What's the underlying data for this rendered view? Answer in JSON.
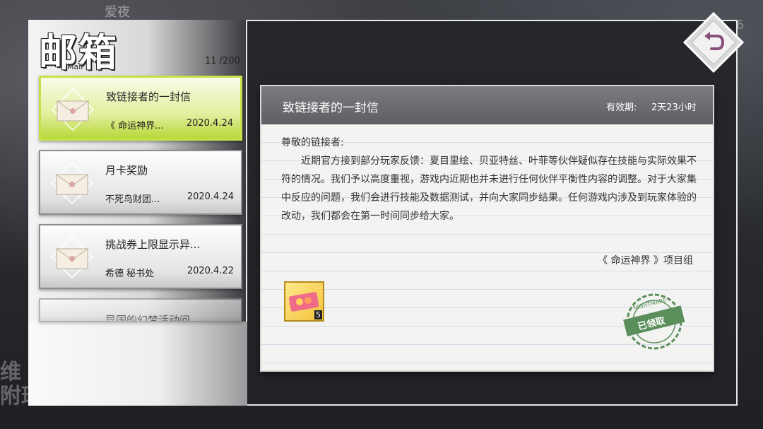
{
  "background": {
    "top_text": "爱夜",
    "corner_number": "6",
    "side_text": "维\n附班"
  },
  "header": {
    "title": "邮箱",
    "subtitle": "Mail",
    "count": "11 /200"
  },
  "mails": [
    {
      "title": "致链接者的一封信",
      "sender": "《 命运神界...",
      "date": "2020.4.24",
      "active": true
    },
    {
      "title": "月卡奖励",
      "sender": "不死鸟财团...",
      "date": "2020.4.24",
      "active": false
    },
    {
      "title": "挑战券上限显示异...",
      "sender": "希德 秘书处",
      "date": "2020.4.22",
      "active": false
    },
    {
      "title": "异国的幻梦活动问...",
      "sender": "",
      "date": "",
      "active": false
    }
  ],
  "detail": {
    "title": "致链接者的一封信",
    "expiry_label": "有效期:",
    "expiry_value": "2天23小时",
    "greeting": "尊敬的链接者:",
    "body": "近期官方接到部分玩家反馈：夏目里绘、贝亚特丝、叶菲等伙伴疑似存在技能与实际效果不符的情况。我们予以高度重视，游戏内近期也并未进行任何伙伴平衡性内容的调整。对于大家集中反应的问题，我们会进行技能及数据测试，并向大家同步结果。任何游戏内涉及到玩家体验的改动，我们都会在第一时间同步给大家。",
    "signature": "《 命运神界 》项目组",
    "reward_quantity": "5",
    "stamp_text": "已领取",
    "stamp_ring_text": "NIGHTMARE"
  },
  "colors": {
    "active_item": "#c6e24a",
    "header_bar": "#6a6b6f",
    "stamp": "#4f8a4f"
  },
  "icons": {
    "mail": "envelope-icon",
    "back": "return-arrow-icon",
    "reward": "ticket-item-icon"
  }
}
